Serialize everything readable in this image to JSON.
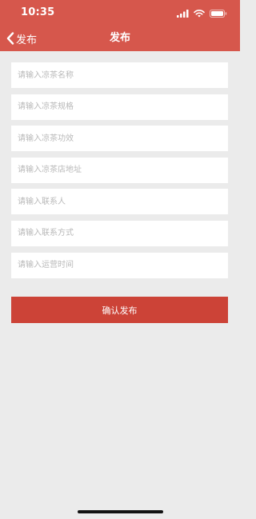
{
  "status_bar": {
    "time": "10:35",
    "icons": [
      "cellular-signal-icon",
      "wifi-icon",
      "battery-icon"
    ]
  },
  "nav": {
    "back_label": "发布",
    "back_icon": "chevron-left-icon",
    "title": "发布"
  },
  "form": {
    "fields": [
      {
        "placeholder": "请输入凉茶名称",
        "value": ""
      },
      {
        "placeholder": "请输入凉茶规格",
        "value": ""
      },
      {
        "placeholder": "请输入凉茶功效",
        "value": ""
      },
      {
        "placeholder": "请输入凉茶店地址",
        "value": ""
      },
      {
        "placeholder": "请输入联系人",
        "value": ""
      },
      {
        "placeholder": "请输入联系方式",
        "value": ""
      },
      {
        "placeholder": "请输入运营时间",
        "value": ""
      }
    ],
    "submit_label": "确认发布"
  },
  "colors": {
    "header_bg": "#d6574c",
    "button_bg": "#cc4337",
    "page_bg": "#ebebeb"
  }
}
